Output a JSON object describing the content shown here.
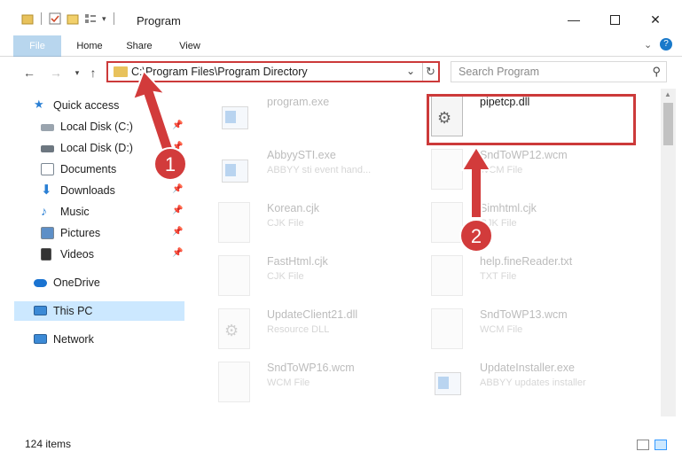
{
  "window": {
    "title": "Program",
    "minimize_icon": "minimize-icon",
    "maximize_icon": "maximize-icon",
    "close_icon": "close-icon"
  },
  "ribbon": {
    "tabs": [
      {
        "label": "File"
      },
      {
        "label": "Home"
      },
      {
        "label": "Share"
      },
      {
        "label": "View"
      }
    ],
    "expand_icon": "chevron-down-icon",
    "help_icon": "help-icon"
  },
  "navigation": {
    "back_icon": "back-arrow-icon",
    "forward_icon": "forward-arrow-icon",
    "recent_icon": "chevron-down-icon",
    "up_icon": "up-arrow-icon",
    "address_path": "C:\\Program Files\\Program Directory",
    "search_placeholder": "Search Program"
  },
  "sidebar": {
    "items": [
      {
        "label": "Quick access",
        "icon": "star-icon",
        "pinned": false
      },
      {
        "label": "Local Disk (C:)",
        "icon": "drive-icon",
        "pinned": true
      },
      {
        "label": "Local Disk (D:)",
        "icon": "drive-icon",
        "pinned": true
      },
      {
        "label": "Documents",
        "icon": "documents-icon",
        "pinned": true
      },
      {
        "label": "Downloads",
        "icon": "download-icon",
        "pinned": true
      },
      {
        "label": "Music",
        "icon": "music-icon",
        "pinned": true
      },
      {
        "label": "Pictures",
        "icon": "pictures-icon",
        "pinned": true
      },
      {
        "label": "Videos",
        "icon": "videos-icon",
        "pinned": true
      },
      {
        "label": "OneDrive",
        "icon": "cloud-icon",
        "pinned": false
      },
      {
        "label": "This PC",
        "icon": "computer-icon",
        "pinned": false,
        "selected": true
      },
      {
        "label": "Network",
        "icon": "network-icon",
        "pinned": false
      }
    ]
  },
  "files": [
    {
      "name": "program.exe",
      "type": "",
      "icon": "exe-icon",
      "highlighted": false
    },
    {
      "name": "pipetcp.dll",
      "type": "",
      "icon": "dll-gear-icon",
      "highlighted": true
    },
    {
      "name": "AbbyySTI.exe",
      "type": "ABBYY sti event hand...",
      "icon": "exe-icon",
      "highlighted": false
    },
    {
      "name": "SndToWP12.wcm",
      "type": "WCM File",
      "icon": "file-icon",
      "highlighted": false
    },
    {
      "name": "Korean.cjk",
      "type": "CJK File",
      "icon": "file-icon",
      "highlighted": false
    },
    {
      "name": "Simhtml.cjk",
      "type": "CJK File",
      "icon": "file-icon",
      "highlighted": false
    },
    {
      "name": "FastHtml.cjk",
      "type": "CJK File",
      "icon": "file-icon",
      "highlighted": false
    },
    {
      "name": "help.fineReader.txt",
      "type": "TXT File",
      "icon": "file-icon",
      "highlighted": false
    },
    {
      "name": "UpdateClient21.dll",
      "type": "Resource DLL",
      "icon": "dll-gear-icon",
      "highlighted": false
    },
    {
      "name": "SndToWP13.wcm",
      "type": "WCM File",
      "icon": "file-icon",
      "highlighted": false
    },
    {
      "name": "SndToWP16.wcm",
      "type": "WCM File",
      "icon": "file-icon",
      "highlighted": false
    },
    {
      "name": "UpdateInstaller.exe",
      "type": "ABBYY updates installer",
      "icon": "exe-icon",
      "highlighted": false
    }
  ],
  "status": {
    "item_count": "124 items"
  },
  "annotations": {
    "step1": "1",
    "step2": "2",
    "color": "#cc3a3a"
  }
}
